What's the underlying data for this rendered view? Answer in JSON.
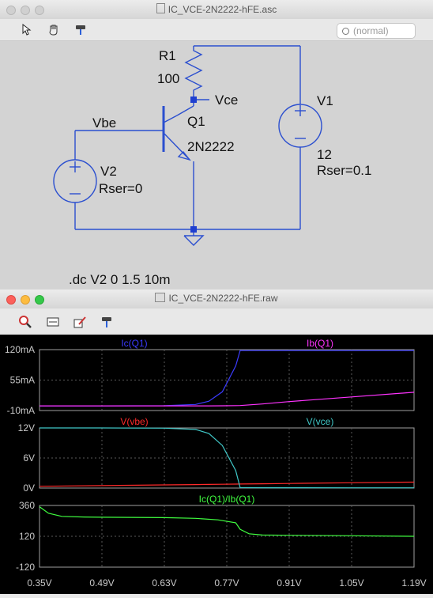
{
  "schematic_window": {
    "title": "IC_VCE-2N2222-hFE.asc",
    "search_placeholder": "(normal)",
    "labels": {
      "r1_name": "R1",
      "r1_value": "100",
      "vce_net": "Vce",
      "vbe_net": "Vbe",
      "q1_name": "Q1",
      "q1_model": "2N2222",
      "v1_name": "V1",
      "v1_value": "12",
      "v1_rser": "Rser=0.1",
      "v2_name": "V2",
      "v2_rser": "Rser=0",
      "directive": ".dc V2 0 1.5  10m"
    }
  },
  "waveform_window": {
    "title": "IC_VCE-2N2222-hFE.raw",
    "panes": [
      {
        "traces": [
          "Ic(Q1)",
          "Ib(Q1)"
        ],
        "trace_colors": [
          "#3b3bff",
          "#ff33ff"
        ],
        "y_ticks": [
          "120mA",
          "55mA",
          "-10mA"
        ]
      },
      {
        "traces": [
          "V(vbe)",
          "V(vce)"
        ],
        "trace_colors": [
          "#ff2a2a",
          "#40c8c8"
        ],
        "y_ticks": [
          "12V",
          "6V",
          "0V"
        ]
      },
      {
        "traces": [
          "Ic(Q1)/Ib(Q1)"
        ],
        "trace_colors": [
          "#40ff40"
        ],
        "y_ticks": [
          "360",
          "120",
          "-120"
        ]
      }
    ],
    "x_ticks": [
      "0.35V",
      "0.49V",
      "0.63V",
      "0.77V",
      "0.91V",
      "1.05V",
      "1.19V"
    ]
  },
  "chart_data": [
    {
      "type": "line",
      "x": [
        0.35,
        0.49,
        0.63,
        0.7,
        0.73,
        0.76,
        0.79,
        0.8,
        0.85,
        0.91,
        1.05,
        1.19
      ],
      "series": [
        {
          "name": "Ic(Q1)",
          "values": [
            0,
            0,
            0.0005,
            0.003,
            0.01,
            0.03,
            0.085,
            0.118,
            0.118,
            0.118,
            0.118,
            0.118
          ]
        },
        {
          "name": "Ib(Q1)",
          "values": [
            0,
            0,
            0,
            0,
            0,
            0.0001,
            0.0004,
            0.0006,
            0.004,
            0.009,
            0.019,
            0.029
          ]
        }
      ],
      "ylim": [
        -0.01,
        0.12
      ]
    },
    {
      "type": "line",
      "x": [
        0.35,
        0.49,
        0.63,
        0.7,
        0.73,
        0.76,
        0.79,
        0.8,
        0.85,
        0.91,
        1.05,
        1.19
      ],
      "series": [
        {
          "name": "V(vbe)",
          "values": [
            0.35,
            0.49,
            0.63,
            0.7,
            0.73,
            0.76,
            0.79,
            0.8,
            0.85,
            0.91,
            1.05,
            1.19
          ]
        },
        {
          "name": "V(vce)",
          "values": [
            12,
            12,
            11.95,
            11.7,
            10.9,
            8.5,
            3.5,
            0.1,
            0.07,
            0.06,
            0.05,
            0.05
          ]
        }
      ],
      "ylim": [
        0,
        12
      ]
    },
    {
      "type": "line",
      "x": [
        0.35,
        0.37,
        0.4,
        0.45,
        0.49,
        0.63,
        0.7,
        0.75,
        0.79,
        0.8,
        0.82,
        0.85,
        0.91,
        1.05,
        1.19
      ],
      "series": [
        {
          "name": "Ic(Q1)/Ib(Q1)",
          "values": [
            350,
            300,
            275,
            270,
            268,
            265,
            260,
            248,
            225,
            175,
            140,
            130,
            128,
            124,
            120
          ]
        }
      ],
      "ylim": [
        -120,
        360
      ]
    }
  ]
}
